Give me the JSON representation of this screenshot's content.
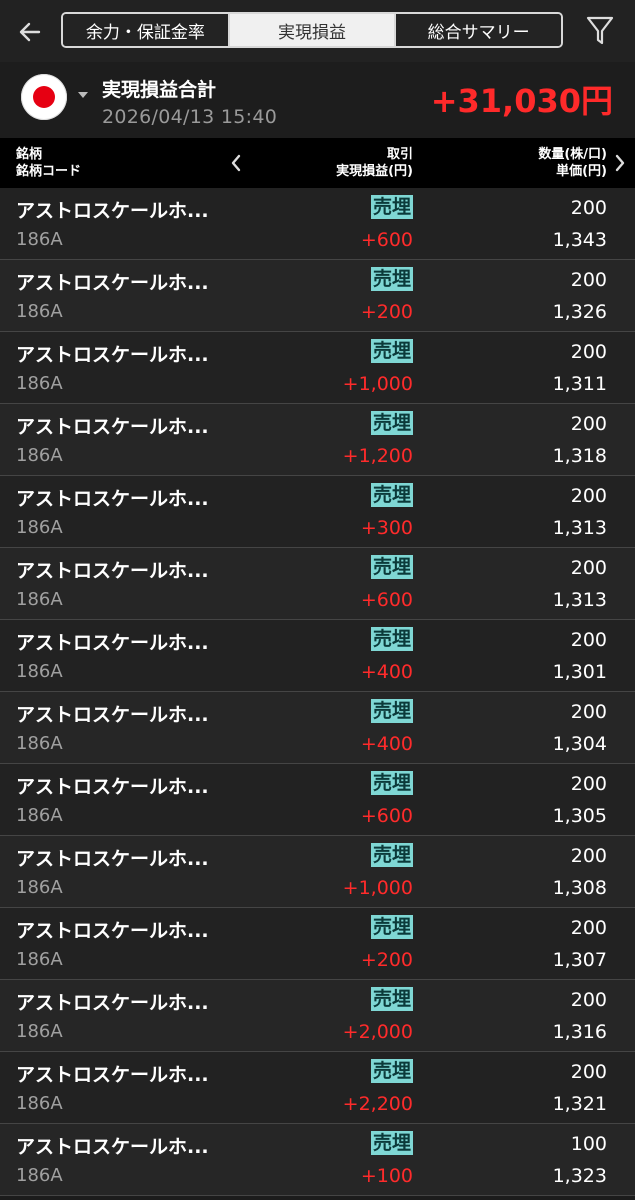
{
  "nav": {
    "back_icon": "arrow-left-icon",
    "filter_icon": "filter-funnel-icon",
    "tabs": [
      {
        "label": "余力・保証金率",
        "active": false
      },
      {
        "label": "実現損益",
        "active": true
      },
      {
        "label": "総合サマリー",
        "active": false
      }
    ]
  },
  "summary": {
    "market_icon": "japan-flag-icon",
    "title": "実現損益合計",
    "datetime": "2026/04/13  15:40",
    "total": "+31,030円",
    "total_color": "#ff2a2a"
  },
  "header": {
    "col1_line1": "銘柄",
    "col1_line2": "銘柄コード",
    "col2_line1": "取引",
    "col2_line2": "実現損益(円)",
    "col3_line1": "数量(株/口)",
    "col3_line2": "単価(円)"
  },
  "colors": {
    "profit": "#ff2b2b",
    "trade_badge_bg": "#7fd7d4",
    "trade_badge_text": "#0b3a3a"
  },
  "rows": [
    {
      "name": "アストロスケールホ...",
      "code": "186A",
      "type": "売埋",
      "pl": "+600",
      "qty": "200",
      "price": "1,343"
    },
    {
      "name": "アストロスケールホ...",
      "code": "186A",
      "type": "売埋",
      "pl": "+200",
      "qty": "200",
      "price": "1,326"
    },
    {
      "name": "アストロスケールホ...",
      "code": "186A",
      "type": "売埋",
      "pl": "+1,000",
      "qty": "200",
      "price": "1,311"
    },
    {
      "name": "アストロスケールホ...",
      "code": "186A",
      "type": "売埋",
      "pl": "+1,200",
      "qty": "200",
      "price": "1,318"
    },
    {
      "name": "アストロスケールホ...",
      "code": "186A",
      "type": "売埋",
      "pl": "+300",
      "qty": "200",
      "price": "1,313"
    },
    {
      "name": "アストロスケールホ...",
      "code": "186A",
      "type": "売埋",
      "pl": "+600",
      "qty": "200",
      "price": "1,313"
    },
    {
      "name": "アストロスケールホ...",
      "code": "186A",
      "type": "売埋",
      "pl": "+400",
      "qty": "200",
      "price": "1,301"
    },
    {
      "name": "アストロスケールホ...",
      "code": "186A",
      "type": "売埋",
      "pl": "+400",
      "qty": "200",
      "price": "1,304"
    },
    {
      "name": "アストロスケールホ...",
      "code": "186A",
      "type": "売埋",
      "pl": "+600",
      "qty": "200",
      "price": "1,305"
    },
    {
      "name": "アストロスケールホ...",
      "code": "186A",
      "type": "売埋",
      "pl": "+1,000",
      "qty": "200",
      "price": "1,308"
    },
    {
      "name": "アストロスケールホ...",
      "code": "186A",
      "type": "売埋",
      "pl": "+200",
      "qty": "200",
      "price": "1,307"
    },
    {
      "name": "アストロスケールホ...",
      "code": "186A",
      "type": "売埋",
      "pl": "+2,000",
      "qty": "200",
      "price": "1,316"
    },
    {
      "name": "アストロスケールホ...",
      "code": "186A",
      "type": "売埋",
      "pl": "+2,200",
      "qty": "200",
      "price": "1,321"
    },
    {
      "name": "アストロスケールホ...",
      "code": "186A",
      "type": "売埋",
      "pl": "+100",
      "qty": "100",
      "price": "1,323"
    }
  ]
}
